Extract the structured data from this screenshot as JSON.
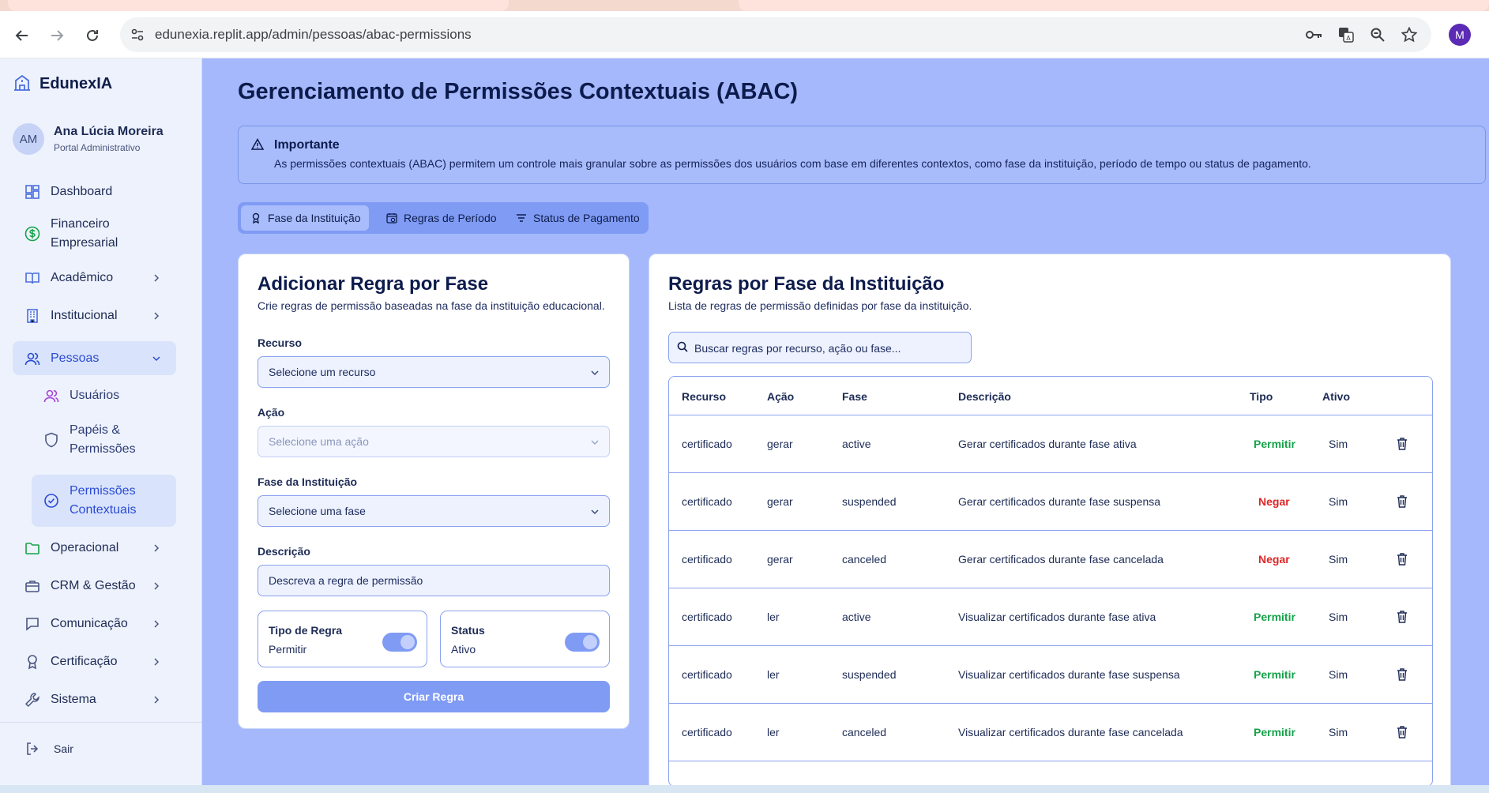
{
  "browser": {
    "url": "edunexia.replit.app/admin/pessoas/abac-permissions",
    "profile_initial": "M"
  },
  "sidebar": {
    "brand": "EdunexIA",
    "user": {
      "initials": "AM",
      "name": "Ana Lúcia Moreira",
      "role": "Portal Administrativo"
    },
    "items": [
      {
        "label": "Dashboard",
        "icon": "dashboard-icon"
      },
      {
        "label": "Financeiro Empresarial",
        "icon": "dollar-icon"
      },
      {
        "label": "Acadêmico",
        "icon": "book-icon"
      },
      {
        "label": "Institucional",
        "icon": "building-icon"
      },
      {
        "label": "Pessoas",
        "icon": "users-icon"
      },
      {
        "label": "Operacional",
        "icon": "folder-icon"
      },
      {
        "label": "CRM & Gestão",
        "icon": "briefcase-icon"
      },
      {
        "label": "Comunicação",
        "icon": "chat-icon"
      },
      {
        "label": "Certificação",
        "icon": "award-icon"
      },
      {
        "label": "Sistema",
        "icon": "wrench-icon"
      }
    ],
    "sub_items": [
      {
        "label": "Usuários",
        "icon": "users-icon"
      },
      {
        "label": "Papéis & Permissões",
        "icon": "shield-icon"
      },
      {
        "label": "Permissões Contextuais",
        "icon": "check-circle-icon"
      }
    ],
    "logout": "Sair"
  },
  "page": {
    "title": "Gerenciamento de Permissões Contextuais (ABAC)",
    "alert": {
      "title": "Importante",
      "text": "As permissões contextuais (ABAC) permitem um controle mais granular sobre as permissões dos usuários com base em diferentes contextos, como fase da instituição, período de tempo ou status de pagamento."
    },
    "tabs": [
      "Fase da Instituição",
      "Regras de Período",
      "Status de Pagamento"
    ]
  },
  "form": {
    "title": "Adicionar Regra por Fase",
    "subtitle": "Crie regras de permissão baseadas na fase da instituição educacional.",
    "resource_label": "Recurso",
    "resource_placeholder": "Selecione um recurso",
    "action_label": "Ação",
    "action_placeholder": "Selecione uma ação",
    "phase_label": "Fase da Instituição",
    "phase_placeholder": "Selecione uma fase",
    "description_label": "Descrição",
    "description_placeholder": "Descreva a regra de permissão",
    "rule_type_label": "Tipo de Regra",
    "rule_type_value": "Permitir",
    "status_label": "Status",
    "status_value": "Ativo",
    "submit": "Criar Regra"
  },
  "rules": {
    "title": "Regras por Fase da Instituição",
    "subtitle": "Lista de regras de permissão definidas por fase da instituição.",
    "search_placeholder": "Buscar regras por recurso, ação ou fase...",
    "columns": [
      "Recurso",
      "Ação",
      "Fase",
      "Descrição",
      "Tipo",
      "Ativo"
    ],
    "rows": [
      [
        "certificado",
        "gerar",
        "active",
        "Gerar certificados durante fase ativa",
        "Permitir",
        "Sim"
      ],
      [
        "certificado",
        "gerar",
        "suspended",
        "Gerar certificados durante fase suspensa",
        "Negar",
        "Sim"
      ],
      [
        "certificado",
        "gerar",
        "canceled",
        "Gerar certificados durante fase cancelada",
        "Negar",
        "Sim"
      ],
      [
        "certificado",
        "ler",
        "active",
        "Visualizar certificados durante fase ativa",
        "Permitir",
        "Sim"
      ],
      [
        "certificado",
        "ler",
        "suspended",
        "Visualizar certificados durante fase suspensa",
        "Permitir",
        "Sim"
      ],
      [
        "certificado",
        "ler",
        "canceled",
        "Visualizar certificados durante fase cancelada",
        "Permitir",
        "Sim"
      ]
    ]
  },
  "colors": {
    "main_bg": "#a4b8fb",
    "accent": "#7f9bf4",
    "allow": "#16a34a",
    "deny": "#dc2626"
  }
}
